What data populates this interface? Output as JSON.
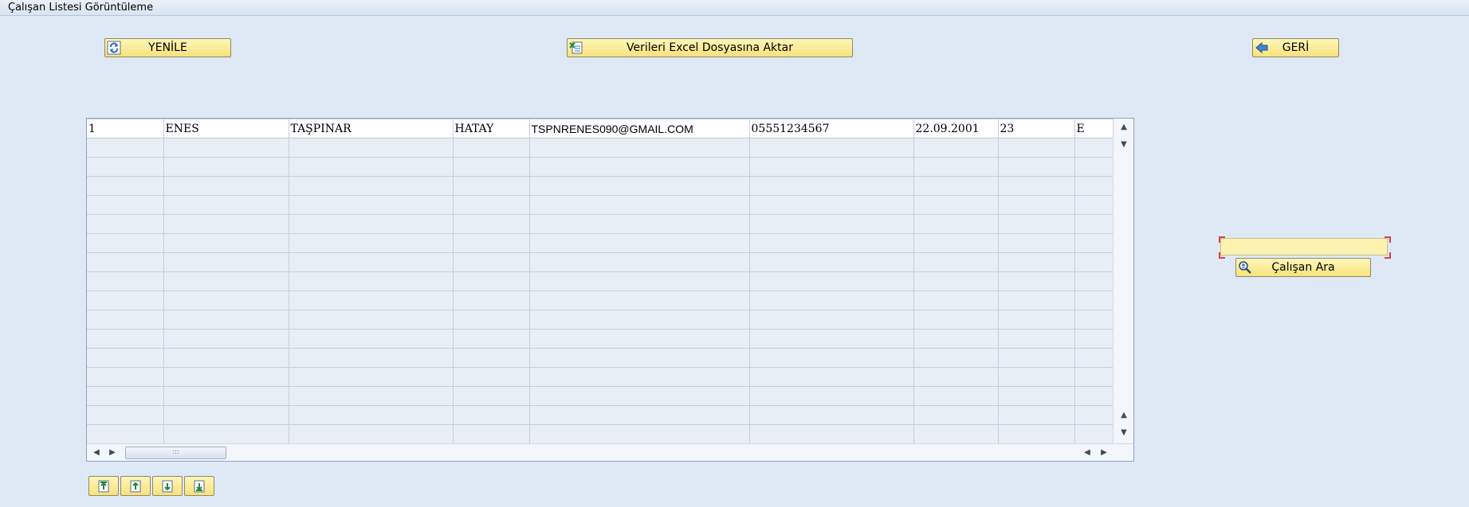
{
  "window": {
    "title": "Çalışan Listesi Görüntüleme"
  },
  "toolbar": {
    "refresh_label": "YENİLE",
    "export_label": "Verileri Excel Dosyasına Aktar",
    "back_label": "GERİ"
  },
  "table": {
    "rows": [
      [
        "1",
        "ENES",
        "TAŞPINAR",
        "HATAY",
        "TSPNRENES090@GMAIL.COM",
        "05551234567",
        "22.09.2001",
        "23",
        "E"
      ]
    ]
  },
  "search": {
    "value": "",
    "button_label": "Çalışan Ara"
  },
  "icons": {
    "refresh": "refresh-icon",
    "excel": "excel-icon",
    "back": "back-arrow-icon",
    "search": "search-person-icon",
    "row_nav": [
      "first-page-icon",
      "page-up-icon",
      "page-down-icon",
      "last-page-icon"
    ]
  },
  "colors": {
    "button_bg": "#f7e27c",
    "background": "#dfe9f5"
  }
}
